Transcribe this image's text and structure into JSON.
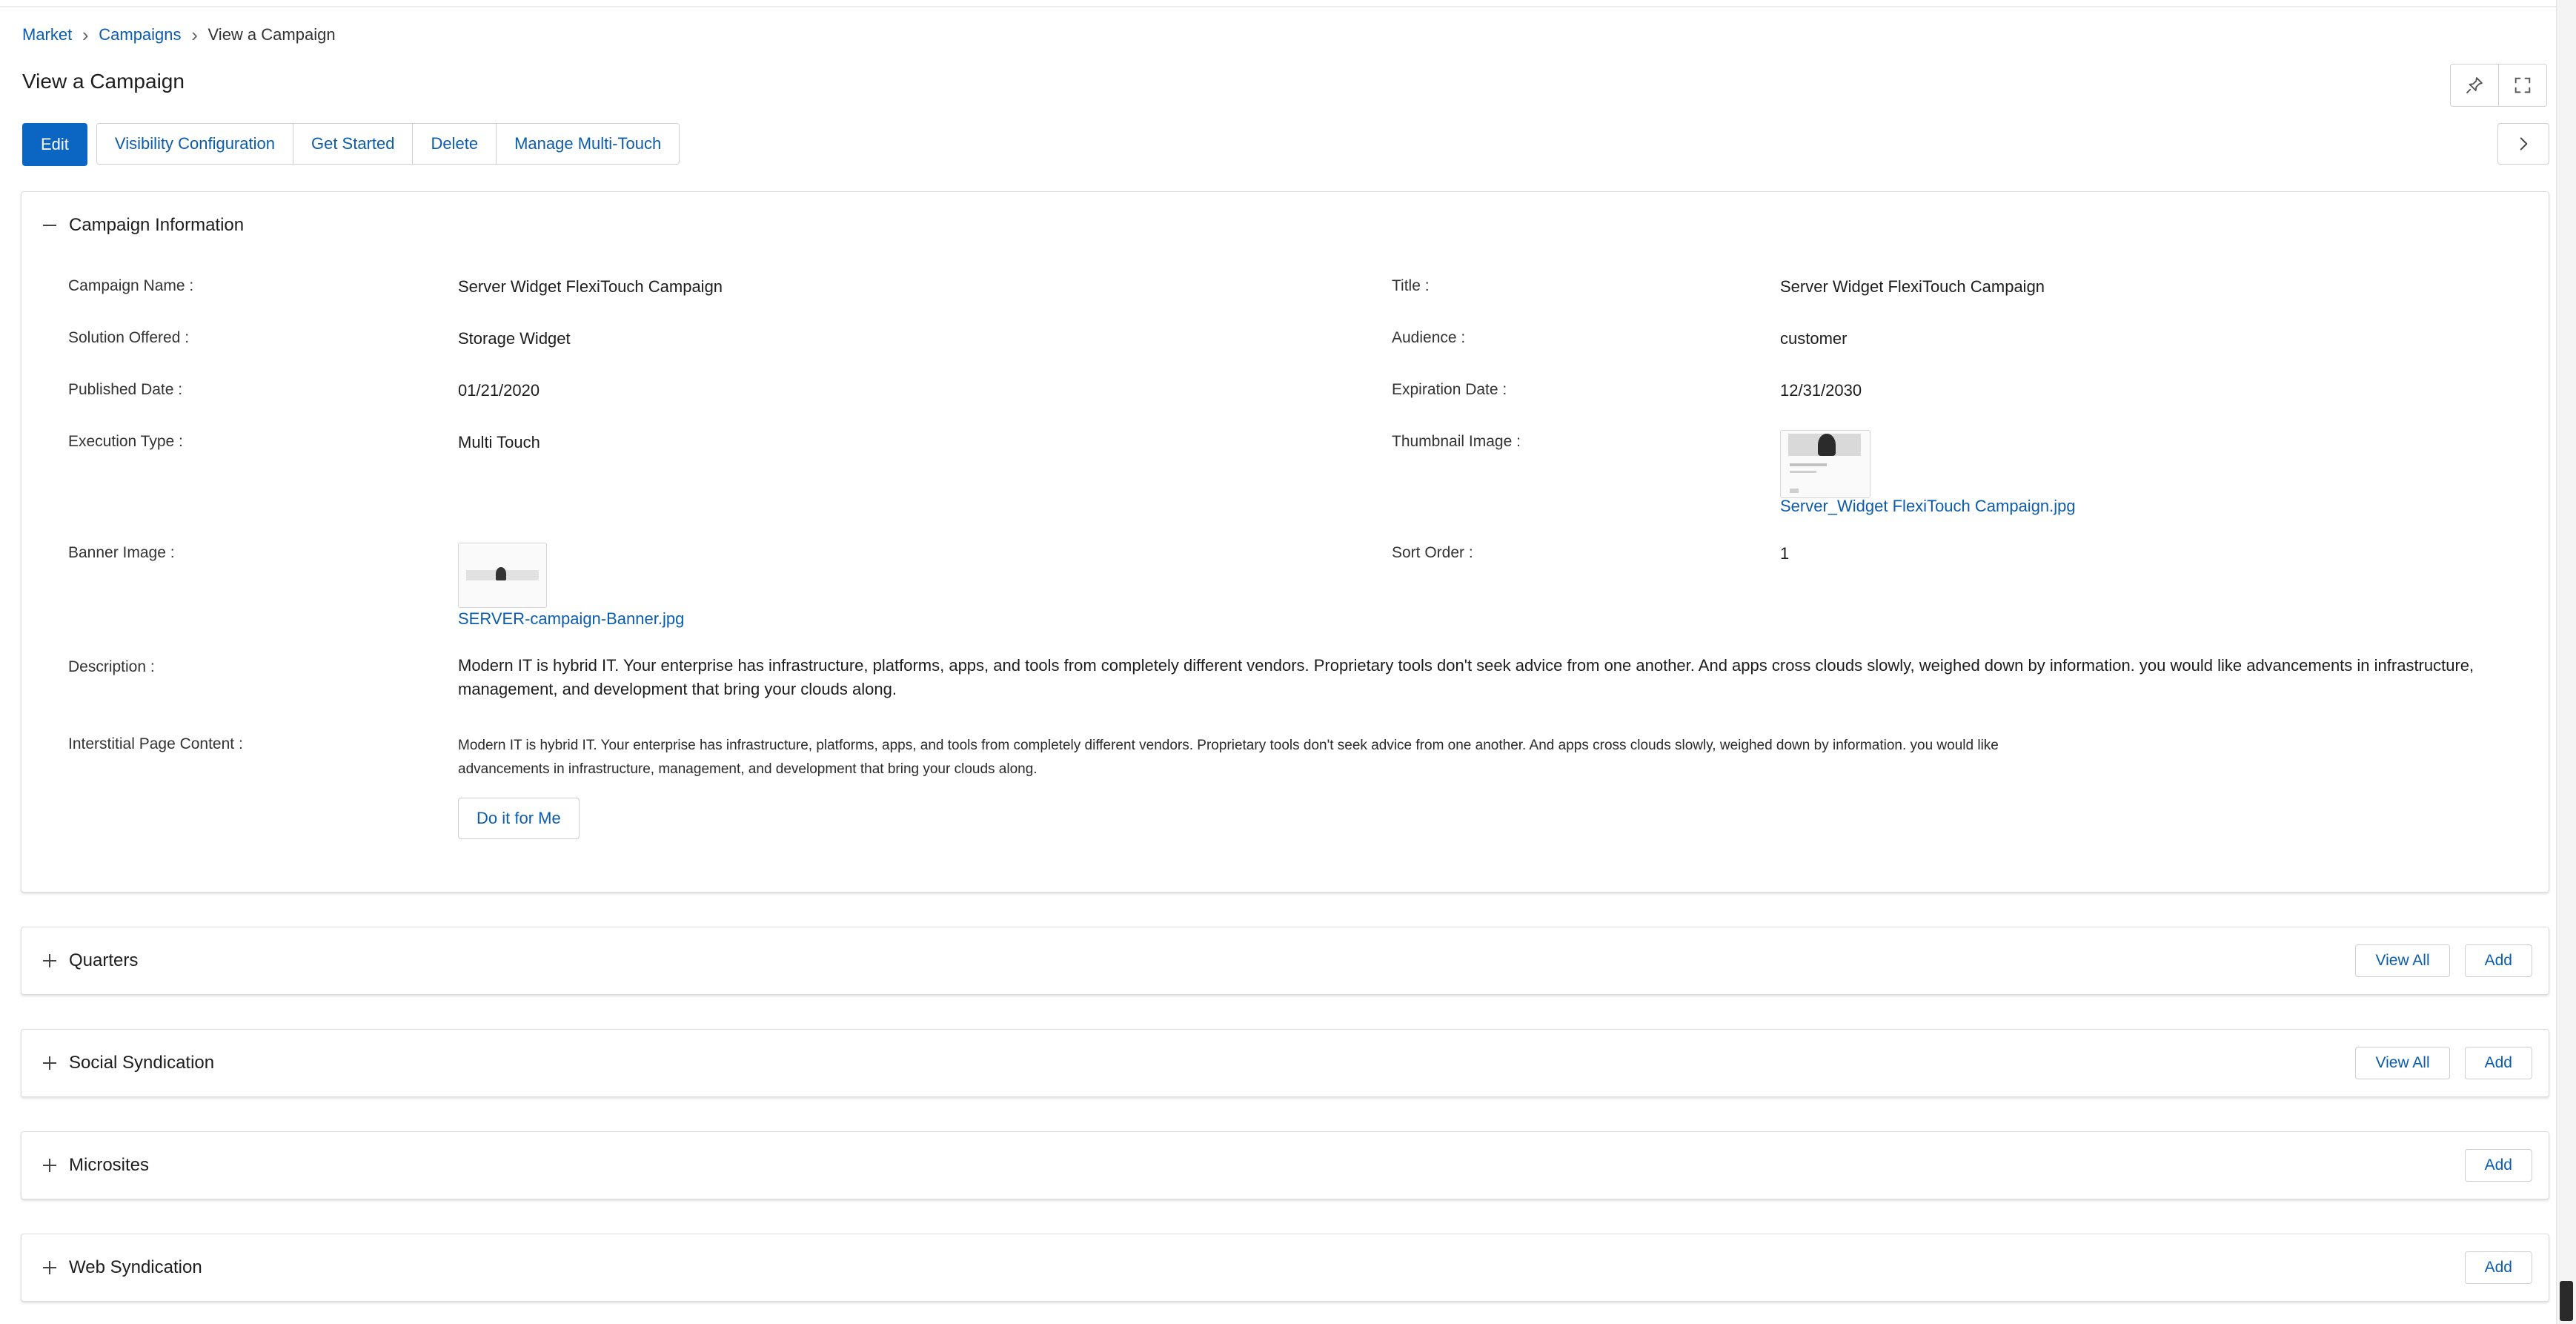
{
  "breadcrumb": {
    "items": [
      {
        "label": "Market"
      },
      {
        "label": "Campaigns"
      }
    ],
    "current": "View a Campaign"
  },
  "page": {
    "title": "View a Campaign"
  },
  "header_icons": [
    "pin-icon",
    "fullscreen-icon"
  ],
  "toolbar": {
    "edit_label": "Edit",
    "buttons": [
      {
        "label": "Visibility Configuration"
      },
      {
        "label": "Get Started"
      },
      {
        "label": "Delete"
      },
      {
        "label": "Manage Multi-Touch"
      }
    ],
    "next_icon": "chevron-right-icon"
  },
  "campaign_info": {
    "title": "Campaign Information",
    "fields": {
      "campaign_name": {
        "label": "Campaign Name :",
        "value": "Server Widget FlexiTouch Campaign"
      },
      "title": {
        "label": "Title :",
        "value": "Server Widget FlexiTouch Campaign"
      },
      "solution_offered": {
        "label": "Solution Offered :",
        "value": "Storage Widget"
      },
      "audience": {
        "label": "Audience :",
        "value": "customer"
      },
      "published_date": {
        "label": "Published Date :",
        "value": "01/21/2020"
      },
      "expiration_date": {
        "label": "Expiration Date :",
        "value": "12/31/2030"
      },
      "execution_type": {
        "label": "Execution Type :",
        "value": "Multi Touch"
      },
      "thumbnail_image": {
        "label": "Thumbnail Image :",
        "file": "Server_Widget FlexiTouch Campaign.jpg"
      },
      "banner_image": {
        "label": "Banner Image :",
        "file": "SERVER-campaign-Banner.jpg"
      },
      "sort_order": {
        "label": "Sort Order :",
        "value": "1"
      },
      "description": {
        "label": "Description :",
        "value": "Modern IT is hybrid IT. Your enterprise has infrastructure, platforms, apps, and tools from completely different vendors. Proprietary tools don't seek advice from one another. And apps cross clouds slowly, weighed down by information. you would like advancements in infrastructure, management, and development that bring your clouds along."
      },
      "interstitial": {
        "label": "Interstitial Page Content :",
        "value": "Modern IT is hybrid IT. Your enterprise has infrastructure, platforms, apps, and tools from completely different vendors. Proprietary tools don't seek advice from one another. And apps cross clouds slowly, weighed down by information. you would like advancements in infrastructure, management, and development that bring your clouds along.",
        "button_label": "Do it for Me"
      }
    }
  },
  "sections": [
    {
      "title": "Quarters",
      "view_all": "View All",
      "add": "Add"
    },
    {
      "title": "Social Syndication",
      "view_all": "View All",
      "add": "Add"
    },
    {
      "title": "Microsites",
      "add": "Add"
    },
    {
      "title": "Web Syndication",
      "add": "Add"
    }
  ],
  "colors": {
    "primary": "#0a66c2",
    "link": "#0b5cad",
    "border": "#cfcfcf"
  }
}
